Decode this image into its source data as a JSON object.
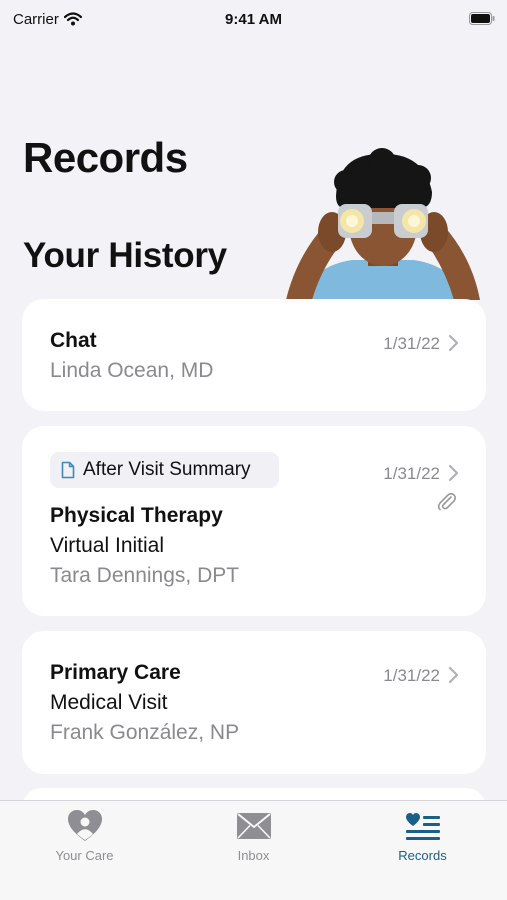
{
  "status_bar": {
    "carrier": "Carrier",
    "time": "9:41 AM"
  },
  "header": {
    "title": "Records",
    "section_title": "Your History"
  },
  "records": [
    {
      "title": "Chat",
      "provider": "Linda Ocean, MD",
      "date": "1/31/22"
    },
    {
      "badge": "After Visit Summary",
      "title": "Physical Therapy",
      "subtitle": "Virtual Initial",
      "provider": "Tara Dennings, DPT",
      "date": "1/31/22",
      "has_attachment": true
    },
    {
      "title": "Primary Care",
      "subtitle": "Medical Visit",
      "provider": "Frank González, NP",
      "date": "1/31/22"
    }
  ],
  "tab_bar": {
    "tabs": [
      {
        "label": "Your Care",
        "icon": "heart-person-icon",
        "active": false
      },
      {
        "label": "Inbox",
        "icon": "envelope-icon",
        "active": false
      },
      {
        "label": "Records",
        "icon": "heart-list-icon",
        "active": true
      }
    ]
  },
  "colors": {
    "background": "#f2f2f7",
    "accent": "#1a5e8a",
    "secondary_text": "#8a8a8e"
  }
}
